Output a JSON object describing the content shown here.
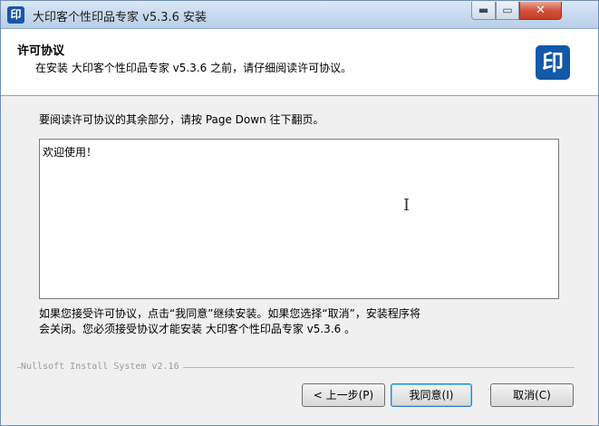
{
  "window": {
    "title": "大印客个性印品专家 v5.3.6 安装",
    "app_icon_glyph": "印",
    "controls": {
      "minimize": "▬",
      "maximize": "▭",
      "close": "✕"
    }
  },
  "header": {
    "title": "许可协议",
    "subtitle": "在安装 大印客个性印品专家 v5.3.6 之前，请仔细阅读许可协议。",
    "logo_glyph": "印",
    "logo_color": "#1259a8"
  },
  "main": {
    "instruction": "要阅读许可协议的其余部分，请按 Page Down 往下翻页。",
    "license_text": "欢迎使用！",
    "notice_line1": "如果您接受许可协议，点击“我同意”继续安装。如果您选择“取消”，安装程序将",
    "notice_line2": "会关闭。您必须接受协议才能安装 大印客个性印品专家 v5.3.6 。"
  },
  "footer": {
    "branding": "Nullsoft Install System v2.16",
    "buttons": {
      "back": "< 上一步(P)",
      "agree": "我同意(I)",
      "cancel": "取消(C)"
    }
  },
  "icons": {
    "cursor": "text-cursor-icon"
  }
}
